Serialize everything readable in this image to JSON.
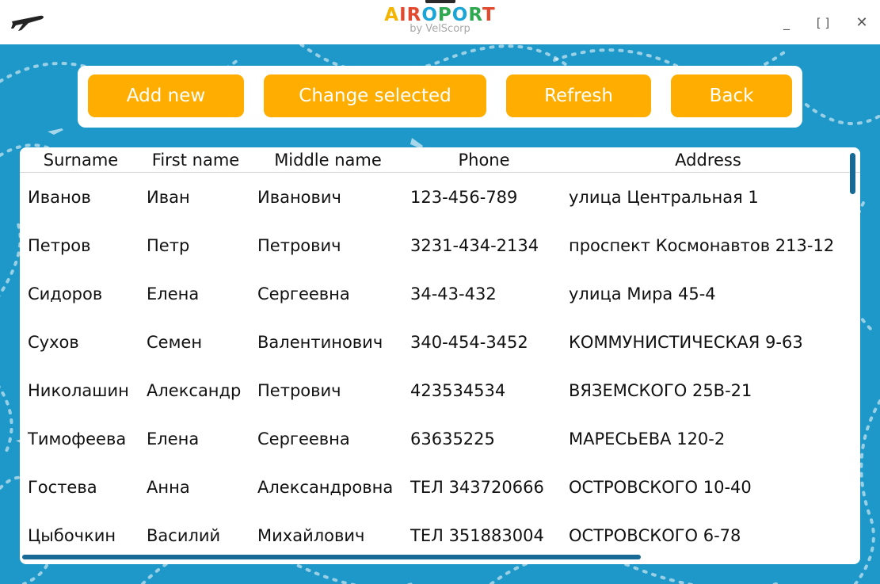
{
  "window": {
    "logo_title": [
      "A",
      "I",
      "R",
      "O",
      "P",
      "O",
      "R",
      "T"
    ],
    "logo_colors": [
      "#f5b400",
      "#e24a2f",
      "#e24a2f",
      "#1aa5d6",
      "#2fa84f",
      "#1aa5d6",
      "#2fa84f",
      "#e24a2f"
    ],
    "logo_subtitle": "by VelScorp",
    "minimize_label": "_",
    "maximize_label": "[ ]",
    "close_label": "✕",
    "app_icon": "airplane-icon"
  },
  "toolbar": {
    "add_label": "Add new",
    "change_label": "Change selected",
    "refresh_label": "Refresh",
    "back_label": "Back"
  },
  "table": {
    "columns": [
      "Surname",
      "First name",
      "Middle name",
      "Phone",
      "Address"
    ],
    "rows": [
      [
        "Иванов",
        "Иван",
        "Иванович",
        "123-456-789",
        "улица Центральная 1"
      ],
      [
        "Петров",
        "Петр",
        "Петрович",
        "3231-434-2134",
        "проспект Космонавтов 213-12"
      ],
      [
        "Сидоров",
        "Елена",
        "Сергеевна",
        "34-43-432",
        "улица Мира 45-4"
      ],
      [
        "Сухов",
        "Семен",
        "Валентинович",
        "340-454-3452",
        "КОММУНИСТИЧЕСКАЯ 9-63"
      ],
      [
        "Николашин",
        "Александр",
        "Петрович",
        "423534534",
        "ВЯЗЕМСКОГО 25В-21"
      ],
      [
        "Тимофеева",
        "Елена",
        "Сергеевна",
        "63635225",
        "МАРЕСЬЕВА 120-2"
      ],
      [
        "Гостева",
        "Анна",
        "Александровна",
        "ТЕЛ 343720666",
        "ОСТРОВСКОГО 10-40"
      ],
      [
        "Цыбочкин",
        "Василий",
        "Михайлович",
        "ТЕЛ 351883004",
        "ОСТРОВСКОГО 6-78"
      ]
    ]
  },
  "colors": {
    "accent": "#ffae00",
    "background": "#1e98c8",
    "scrollbar": "#176a95"
  }
}
